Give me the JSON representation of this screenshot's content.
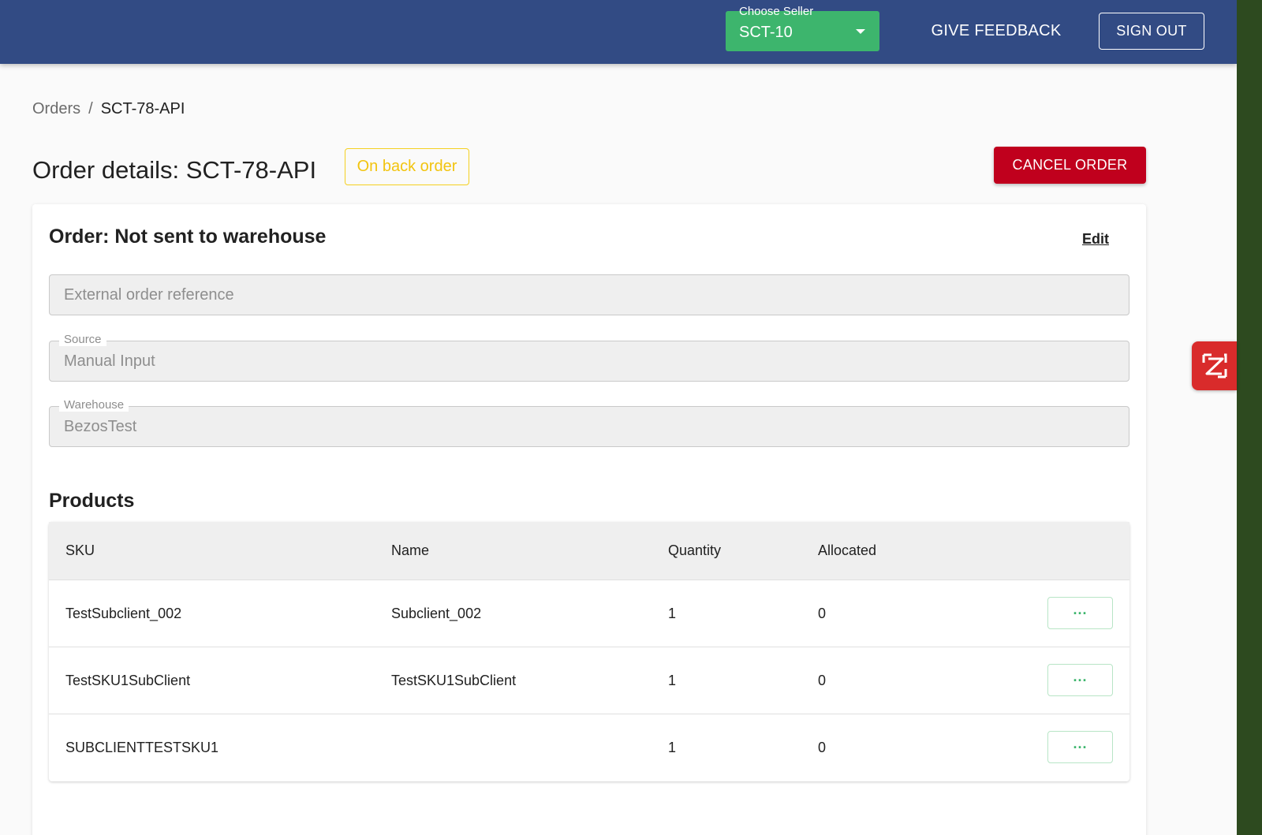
{
  "header": {
    "seller_label": "Choose Seller",
    "seller_value": "SCT-10",
    "feedback_label": "GIVE FEEDBACK",
    "signout_label": "SIGN OUT"
  },
  "breadcrumb": {
    "parent": "Orders",
    "separator": "/",
    "current": "SCT-78-API"
  },
  "page": {
    "title": "Order details: SCT-78-API",
    "status": "On back order",
    "cancel_label": "CANCEL ORDER"
  },
  "order": {
    "title": "Order: Not sent to warehouse",
    "edit_label": "Edit",
    "external_ref_placeholder": "External order reference",
    "source_label": "Source",
    "source_value": "Manual Input",
    "warehouse_label": "Warehouse",
    "warehouse_value": "BezosTest"
  },
  "products": {
    "title": "Products",
    "columns": {
      "sku": "SKU",
      "name": "Name",
      "quantity": "Quantity",
      "allocated": "Allocated"
    },
    "rows": [
      {
        "sku": "TestSubclient_002",
        "name": "Subclient_002",
        "quantity": "1",
        "allocated": "0",
        "action": "..."
      },
      {
        "sku": "TestSKU1SubClient",
        "name": "TestSKU1SubClient",
        "quantity": "1",
        "allocated": "0",
        "action": "..."
      },
      {
        "sku": "SUBCLIENTTESTSKU1",
        "name": "",
        "quantity": "1",
        "allocated": "0",
        "action": "..."
      }
    ]
  },
  "colors": {
    "header_bg": "#324b84",
    "seller_bg": "#3db56d",
    "cancel_bg": "#c0001d",
    "status_color": "#f2c40f",
    "widget_bg": "#d92b2b"
  },
  "icons": {
    "seller_caret": "caret-down-icon",
    "widget": "zendesk-z-icon"
  }
}
